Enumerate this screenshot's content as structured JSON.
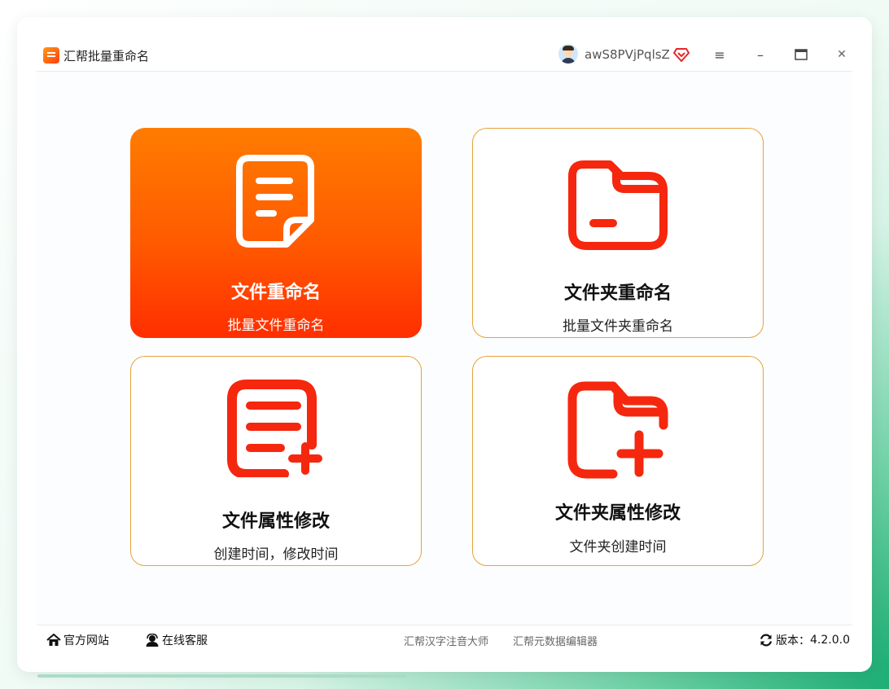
{
  "app": {
    "title": "汇帮批量重命名"
  },
  "user": {
    "name": "awS8PVjPqlsZ"
  },
  "window_controls": {
    "menu": "≡",
    "minimize": "–",
    "maximize": "▭",
    "close": "✕"
  },
  "cards": [
    {
      "title": "文件重命名",
      "subtitle": "批量文件重命名",
      "icon": "document-icon"
    },
    {
      "title": "文件夹重命名",
      "subtitle": "批量文件夹重命名",
      "icon": "folder-icon"
    },
    {
      "title": "文件属性修改",
      "subtitle": "创建时间，修改时间",
      "icon": "document-add-icon"
    },
    {
      "title": "文件夹属性修改",
      "subtitle": "文件夹创建时间",
      "icon": "folder-add-icon"
    }
  ],
  "footer": {
    "website": "官方网站",
    "support": "在线客服",
    "link1": "汇帮汉字注音大师",
    "link2": "汇帮元数据编辑器",
    "version_label": "版本：",
    "version": "4.2.0.0"
  },
  "colors": {
    "accent": "#ff4d00",
    "icon_red": "#f5270e",
    "border": "#e7a23d"
  }
}
